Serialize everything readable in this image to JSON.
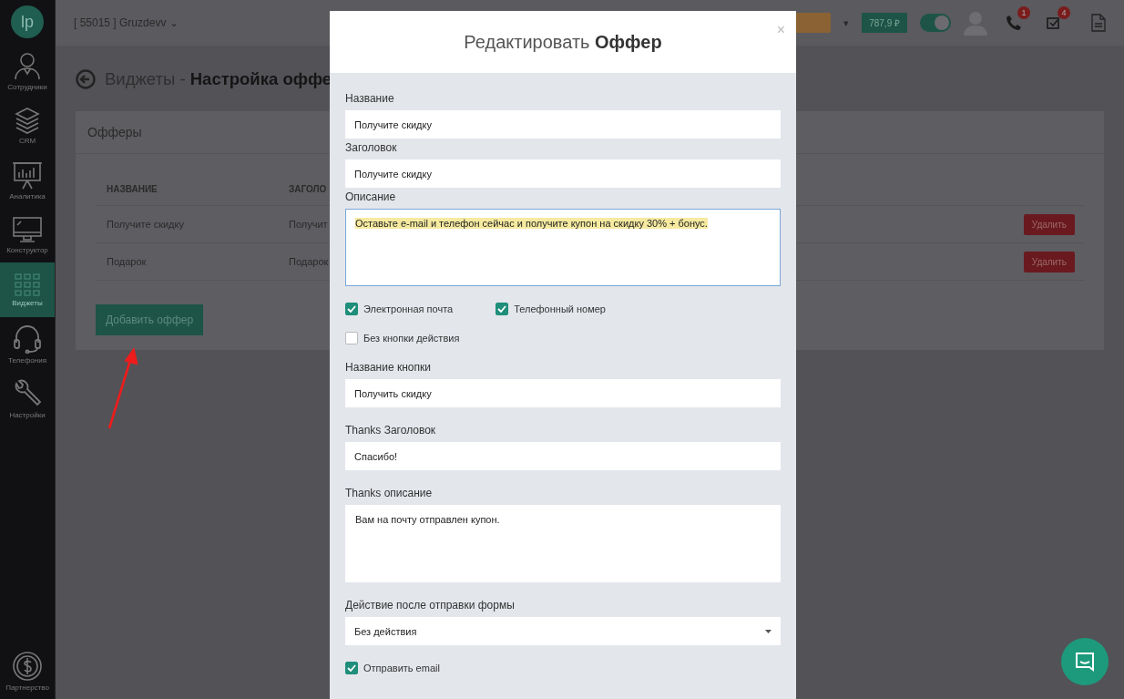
{
  "sidebar": {
    "logo": "lp",
    "items": [
      {
        "label": "Сотрудники",
        "selected": false
      },
      {
        "label": "CRM",
        "selected": false
      },
      {
        "label": "Аналитика",
        "selected": false
      },
      {
        "label": "Конструктор",
        "selected": false
      },
      {
        "label": "Виджеты",
        "selected": true
      },
      {
        "label": "Телефония",
        "selected": false
      },
      {
        "label": "Настройки",
        "selected": false
      }
    ],
    "footer": {
      "label": "Партнерство"
    }
  },
  "topbar": {
    "account": "[ 55015 ] Gruzdevv ⌄",
    "caret": "▾",
    "balance": "787,9 ₽",
    "toggle_on": true,
    "calls_badge": "1",
    "tasks_badge": "4"
  },
  "page": {
    "title_light": "Виджеты - ",
    "title_bold": "Настройка оффе",
    "card_title": "Офферы",
    "columns": [
      "НАЗВАНИЕ",
      "ЗАГОЛО"
    ],
    "rows": [
      {
        "name": "Получите скидку",
        "heading": "Получит",
        "action": "Удалить"
      },
      {
        "name": "Подарок",
        "heading": "Подарок",
        "action": "Удалить"
      }
    ],
    "add_button": "Добавить оффер"
  },
  "modal": {
    "title_light": "Редактировать ",
    "title_bold": "Оффер",
    "close": "×",
    "fields": [
      {
        "kind": "text",
        "label": "Название",
        "value": "Получите скидку"
      },
      {
        "kind": "text",
        "label": "Заголовок",
        "value": "Получите скидку"
      },
      {
        "kind": "textarea",
        "label": "Описание",
        "value": "Оставьте e-mail и телефон сейчас и получите купон на скидку 30% + бонус.",
        "highlighted": true,
        "focused": true
      },
      {
        "kind": "checkboxes",
        "options": [
          {
            "label": "Электронная почта",
            "checked": true
          },
          {
            "label": "Телефонный номер",
            "checked": true
          }
        ]
      },
      {
        "kind": "checkboxes",
        "options": [
          {
            "label": "Без кнопки действия",
            "checked": false
          }
        ]
      },
      {
        "kind": "text",
        "label": "Название кнопки",
        "value": "Получить скидку"
      },
      {
        "kind": "text",
        "label": "Thanks Заголовок",
        "value": "Спасибо!"
      },
      {
        "kind": "textarea",
        "label": "Thanks описание",
        "value": "Вам на почту отправлен купон.",
        "highlighted": false,
        "focused": false
      },
      {
        "kind": "select",
        "label": "Действие после отправки формы",
        "value": "Без действия"
      },
      {
        "kind": "checkboxes",
        "options": [
          {
            "label": "Отправить email",
            "checked": true
          }
        ]
      }
    ]
  }
}
